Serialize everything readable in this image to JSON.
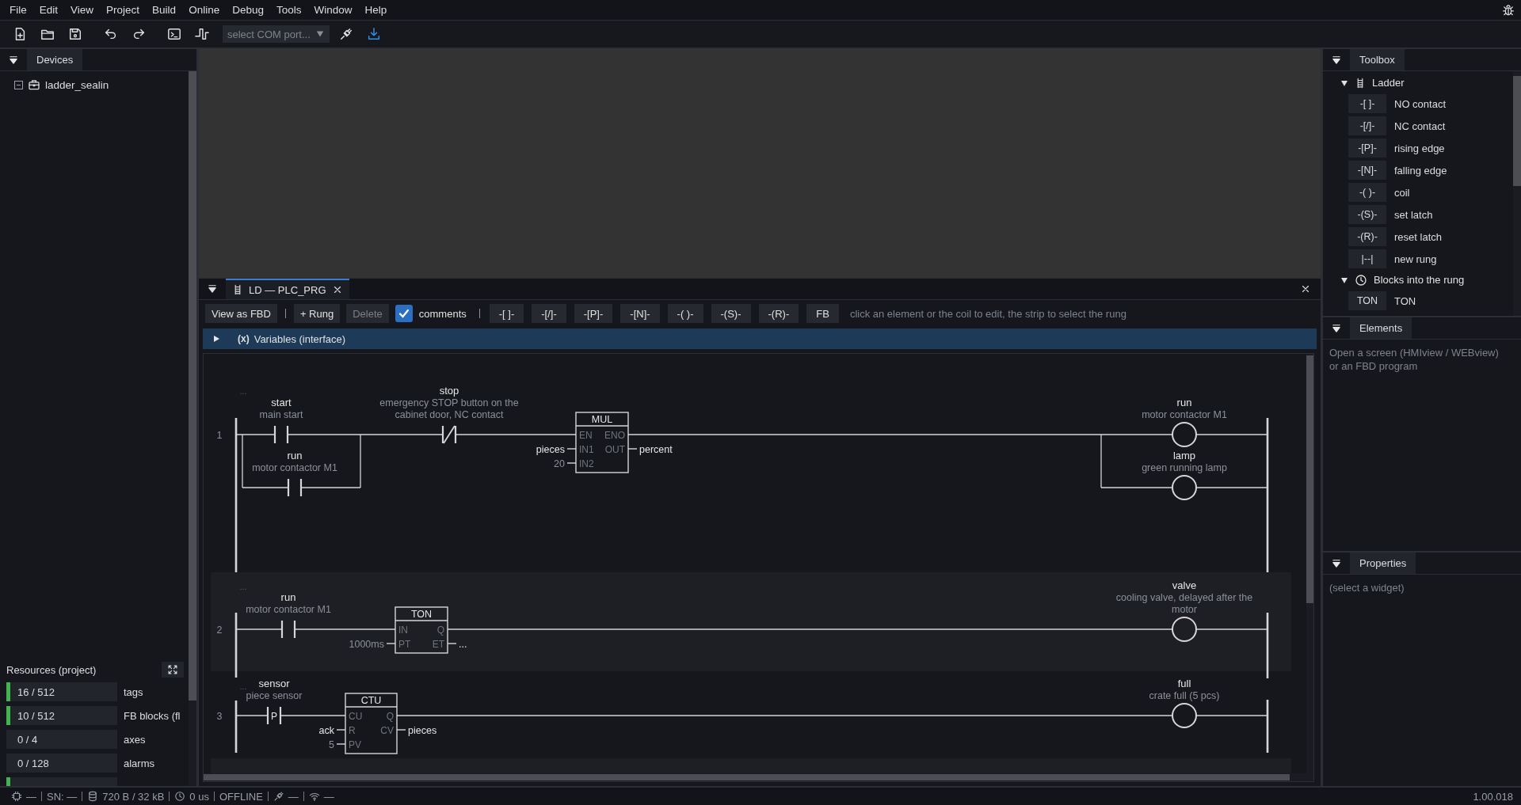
{
  "menu": [
    "File",
    "Edit",
    "View",
    "Project",
    "Build",
    "Online",
    "Debug",
    "Tools",
    "Window",
    "Help"
  ],
  "toolbar": {
    "port_combo": {
      "placeholder": "select COM port..."
    }
  },
  "devices": {
    "title": "Devices",
    "tree": [
      {
        "label": "ladder_sealin",
        "expanded": true
      }
    ]
  },
  "resources": {
    "title": "Resources (project)",
    "rows": [
      {
        "value": "16 / 512",
        "label": "tags",
        "level": 0.03
      },
      {
        "value": "10 / 512",
        "label": "FB blocks (fl",
        "level": 0.02
      },
      {
        "value": "0 / 4",
        "label": "axes",
        "level": 0
      },
      {
        "value": "0 / 128",
        "label": "alarms",
        "level": 0
      },
      {
        "level": 0.03
      }
    ]
  },
  "editor": {
    "tab": {
      "title": "LD — PLC_PRG"
    },
    "toolbar": {
      "buttons": [
        {
          "label": "View as FBD",
          "disabled": false
        },
        {
          "label": "+ Rung",
          "disabled": false
        },
        {
          "label": "Delete",
          "disabled": true
        }
      ],
      "comments": {
        "label": "comments",
        "checked": true
      },
      "inserts": [
        "-[ ]-",
        "-[/]-",
        "-[P]-",
        "-[N]-",
        "-( )-",
        "-(S)-",
        "-(R)-",
        "FB"
      ],
      "hint": "click an element or the coil to edit, the strip to select the rung"
    },
    "variables": {
      "icon_text": "(x)",
      "label": "Variables (interface)",
      "expanded": false
    },
    "rungs": [
      {
        "number": "1",
        "comment": "...",
        "elements": [
          {
            "kind": "no_contact",
            "name": "start",
            "comment": "main start"
          },
          {
            "kind": "no_contact",
            "name": "run",
            "comment": "motor contactor M1"
          },
          {
            "kind": "nc_contact",
            "name": "stop",
            "comment": "emergency STOP button on the cabinet door, NC contact"
          },
          {
            "kind": "block",
            "type": "MUL",
            "inputs": [
              {
                "pin": "EN"
              },
              {
                "pin": "IN1",
                "value": "pieces",
                "literal": false
              },
              {
                "pin": "IN2",
                "value": "20",
                "literal": true
              }
            ],
            "outputs": [
              {
                "pin": "ENO"
              },
              {
                "pin": "OUT",
                "value": "percent",
                "literal": false
              }
            ]
          },
          {
            "kind": "coil",
            "name": "run",
            "comment": "motor contactor M1"
          },
          {
            "kind": "coil",
            "name": "lamp",
            "comment": "green running lamp"
          }
        ]
      },
      {
        "number": "2",
        "comment": "...",
        "elements": [
          {
            "kind": "no_contact",
            "name": "run",
            "comment": "motor contactor M1"
          },
          {
            "kind": "block",
            "type": "TON",
            "inputs": [
              {
                "pin": "IN"
              },
              {
                "pin": "PT",
                "value": "1000ms",
                "literal": true
              }
            ],
            "outputs": [
              {
                "pin": "Q"
              },
              {
                "pin": "ET",
                "value": "...",
                "literal": false
              }
            ]
          },
          {
            "kind": "coil",
            "name": "valve",
            "comment": "cooling valve, delayed after the motor"
          }
        ]
      },
      {
        "number": "3",
        "comment": "...",
        "elements": [
          {
            "kind": "edge_contact",
            "edge": "P",
            "name": "sensor",
            "comment": "piece sensor"
          },
          {
            "kind": "block",
            "type": "CTU",
            "inputs": [
              {
                "pin": "CU"
              },
              {
                "pin": "R",
                "value": "ack",
                "literal": false
              },
              {
                "pin": "PV",
                "value": "5",
                "literal": true
              }
            ],
            "outputs": [
              {
                "pin": "Q"
              },
              {
                "pin": "CV",
                "value": "pieces",
                "literal": false
              }
            ]
          },
          {
            "kind": "coil",
            "name": "full",
            "comment": "crate full (5 pcs)"
          }
        ]
      }
    ]
  },
  "toolbox": {
    "title": "Toolbox",
    "groups": [
      {
        "kind": "ladder",
        "label": "Ladder",
        "expanded": true,
        "items": [
          {
            "code": "-[ ]-",
            "label": "NO contact"
          },
          {
            "code": "-[/]-",
            "label": "NC contact"
          },
          {
            "code": "-[P]-",
            "label": "rising edge"
          },
          {
            "code": "-[N]-",
            "label": "falling edge"
          },
          {
            "code": "-( )-",
            "label": "coil"
          },
          {
            "code": "-(S)-",
            "label": "set latch"
          },
          {
            "code": "-(R)-",
            "label": "reset latch"
          },
          {
            "code": "|--|",
            "label": "new rung"
          }
        ]
      },
      {
        "kind": "blocks",
        "label": "Blocks into the rung",
        "expanded": true,
        "items": [
          {
            "code": "TON",
            "label": "TON"
          }
        ]
      }
    ]
  },
  "elements": {
    "title": "Elements",
    "message": "Open a screen (HMIview / WEBview) or an FBD program"
  },
  "properties": {
    "title": "Properties",
    "message": "(select a widget)"
  },
  "status_bar": {
    "items": [
      {
        "kind": "chip",
        "text": "—"
      },
      {
        "kind": "text",
        "text": "SN: —"
      },
      {
        "kind": "storage",
        "text": "720 B / 32 kB"
      },
      {
        "kind": "clock",
        "text": "0 us"
      },
      {
        "kind": "text",
        "text": "OFFLINE"
      },
      {
        "kind": "plug",
        "text": "—"
      },
      {
        "kind": "wifi",
        "text": "—"
      }
    ],
    "version": "1.00.018"
  }
}
